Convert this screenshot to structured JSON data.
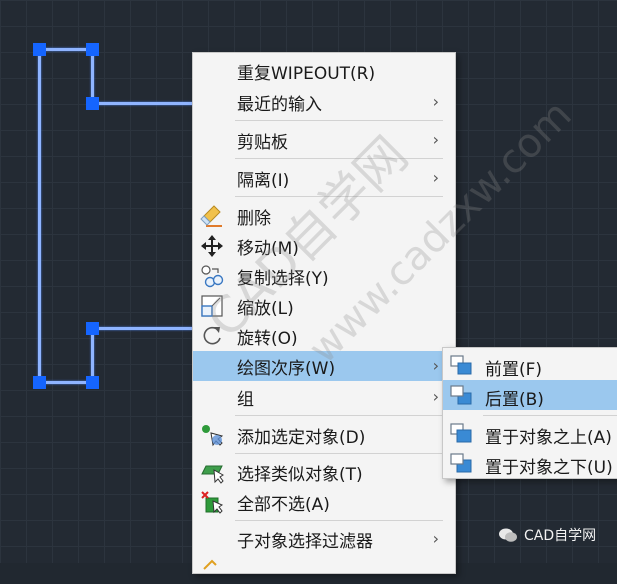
{
  "colors": {
    "canvas": "#232a33",
    "selected_line": "#8fb4ff",
    "grip": "#1565ff",
    "menu_bg": "#f4f4f4",
    "highlight": "#9bc8ee"
  },
  "context_menu": {
    "items": [
      {
        "label": "重复WIPEOUT(R)",
        "icon": "",
        "submenu": false
      },
      {
        "label": "最近的输入",
        "icon": "",
        "submenu": true
      },
      {
        "label": "剪贴板",
        "icon": "",
        "submenu": true
      },
      {
        "label": "隔离(I)",
        "icon": "",
        "submenu": true
      },
      {
        "label": "删除",
        "icon": "eraser-icon",
        "submenu": false
      },
      {
        "label": "移动(M)",
        "icon": "move-icon",
        "submenu": false
      },
      {
        "label": "复制选择(Y)",
        "icon": "copy-icon",
        "submenu": false
      },
      {
        "label": "缩放(L)",
        "icon": "scale-icon",
        "submenu": false
      },
      {
        "label": "旋转(O)",
        "icon": "rotate-icon",
        "submenu": false
      },
      {
        "label": "绘图次序(W)",
        "icon": "",
        "submenu": true,
        "active": true
      },
      {
        "label": "组",
        "icon": "",
        "submenu": true
      },
      {
        "label": "添加选定对象(D)",
        "icon": "add-selected-icon",
        "submenu": false
      },
      {
        "label": "选择类似对象(T)",
        "icon": "select-similar-icon",
        "submenu": false
      },
      {
        "label": "全部不选(A)",
        "icon": "deselect-all-icon",
        "submenu": false
      },
      {
        "label": "子对象选择过滤器",
        "icon": "",
        "submenu": true
      }
    ]
  },
  "draw_order_submenu": {
    "items": [
      {
        "label": "前置(F)",
        "icon": "bring-to-front-icon"
      },
      {
        "label": "后置(B)",
        "icon": "send-to-back-icon",
        "active": true
      },
      {
        "label": "置于对象之上(A)",
        "icon": "bring-above-icon"
      },
      {
        "label": "置于对象之下(U)",
        "icon": "send-under-icon"
      }
    ]
  },
  "submenu_arrow": "›",
  "watermark": {
    "text1": "CAD自学网",
    "text2": "www.cadzxw.com"
  },
  "badge": {
    "text": "CAD自学网"
  }
}
